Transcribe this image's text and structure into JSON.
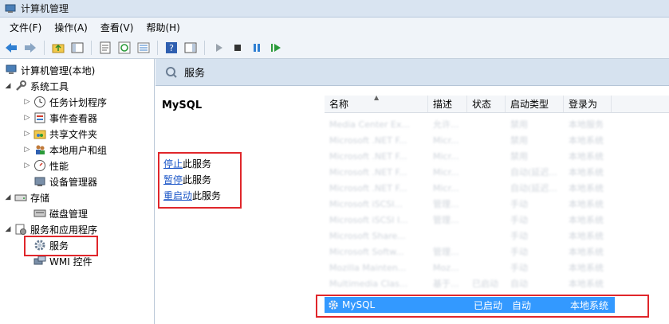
{
  "window": {
    "title": "计算机管理"
  },
  "menu": [
    "文件(F)",
    "操作(A)",
    "查看(V)",
    "帮助(H)"
  ],
  "tree": {
    "root": "计算机管理(本地)",
    "system_tools": "系统工具",
    "task_scheduler": "任务计划程序",
    "event_viewer": "事件查看器",
    "shared_folders": "共享文件夹",
    "local_users": "本地用户和组",
    "performance": "性能",
    "device_manager": "设备管理器",
    "storage": "存储",
    "disk_management": "磁盘管理",
    "services_apps": "服务和应用程序",
    "services": "服务",
    "wmi": "WMI 控件"
  },
  "right_header": {
    "label": "服务"
  },
  "detail": {
    "service_name": "MySQL",
    "stop": {
      "link": "停止",
      "rest": "此服务"
    },
    "pause": {
      "link": "暂停",
      "rest": "此服务"
    },
    "restart": {
      "link": "重启动",
      "rest": "此服务"
    }
  },
  "columns": {
    "name": "名称",
    "desc": "描述",
    "status": "状态",
    "type": "启动类型",
    "logon": "登录为"
  },
  "blurred_rows": [
    [
      "Media Center Ex...",
      "允许...",
      "",
      "禁用",
      "本地服务"
    ],
    [
      "Microsoft .NET F...",
      "Micr...",
      "",
      "禁用",
      "本地系统"
    ],
    [
      "Microsoft .NET F...",
      "Micr...",
      "",
      "禁用",
      "本地系统"
    ],
    [
      "Microsoft .NET F...",
      "Micr...",
      "",
      "自动(延迟...",
      "本地系统"
    ],
    [
      "Microsoft .NET F...",
      "Micr...",
      "",
      "自动(延迟...",
      "本地系统"
    ],
    [
      "Microsoft iSCSI...",
      "管理...",
      "",
      "手动",
      "本地系统"
    ],
    [
      "Microsoft iSCSI I...",
      "管理...",
      "",
      "手动",
      "本地系统"
    ],
    [
      "Microsoft Share...",
      "",
      "",
      "手动",
      "本地系统"
    ],
    [
      "Microsoft Softw...",
      "管理...",
      "",
      "手动",
      "本地系统"
    ],
    [
      "Mozilla Mainten...",
      "Moz...",
      "",
      "手动",
      "本地系统"
    ],
    [
      "Multimedia Clas...",
      "基于...",
      "已启动",
      "自动",
      "本地系统"
    ]
  ],
  "selected_row": {
    "name": "MySQL",
    "status": "已启动",
    "type": "自动",
    "logon": "本地系统"
  },
  "colors": {
    "accent": "#3399ff",
    "highlight_border": "#e0262b",
    "link": "#1a55c7"
  }
}
